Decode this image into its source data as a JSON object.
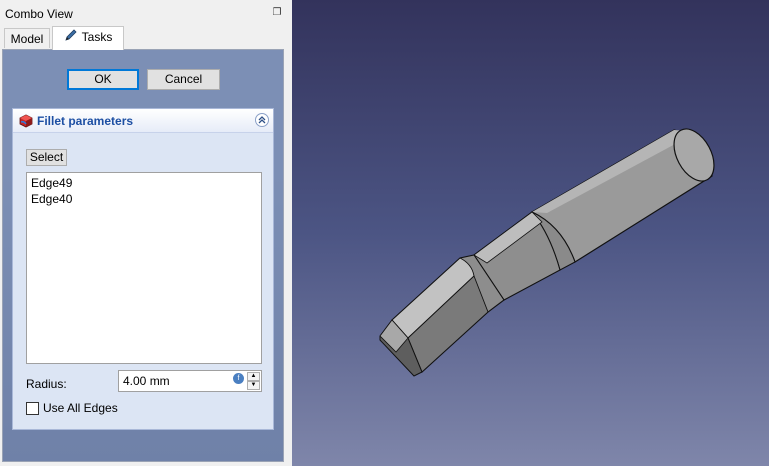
{
  "combo_view": {
    "title": "Combo View",
    "tabs": [
      {
        "label": "Model",
        "active": false
      },
      {
        "label": "Tasks",
        "active": true
      }
    ]
  },
  "task_panel": {
    "ok_label": "OK",
    "cancel_label": "Cancel",
    "fillet": {
      "title": "Fillet parameters",
      "select_label": "Select",
      "edges": [
        "Edge49",
        "Edge40"
      ],
      "radius_label": "Radius:",
      "radius_value": "4.00 mm",
      "use_all_edges_label": "Use All Edges",
      "use_all_edges_checked": false
    }
  },
  "icons": {
    "float": "float-window-icon",
    "tasks": "pencil-icon",
    "fillet": "fillet-icon",
    "collapse": "collapse-chevrons-icon",
    "formula": "formula-icon"
  },
  "colors": {
    "task_bg": "#7c8fb5",
    "fillet_title": "#1d4fa3",
    "viewport_top": "#33335c",
    "viewport_bottom": "#7f86aa"
  }
}
